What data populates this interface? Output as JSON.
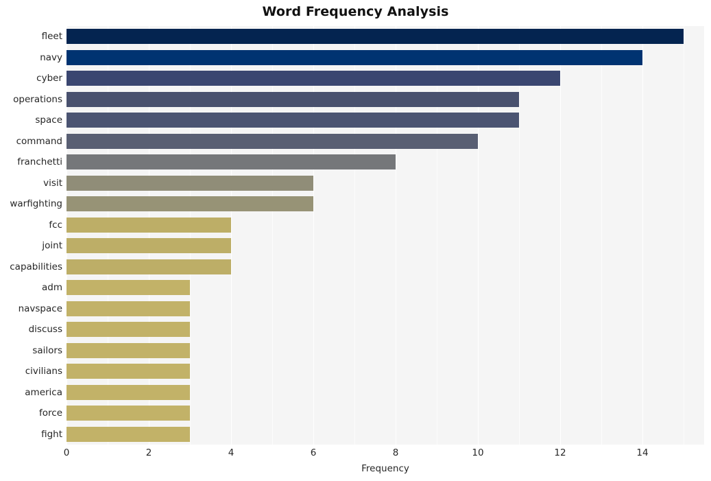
{
  "chart_data": {
    "type": "bar",
    "orientation": "horizontal",
    "title": "Word Frequency Analysis",
    "xlabel": "Frequency",
    "ylabel": "",
    "xlim": [
      0,
      15.5
    ],
    "xticks": [
      0,
      2,
      4,
      6,
      8,
      10,
      12,
      14
    ],
    "xtick_labels": [
      "0",
      "2",
      "4",
      "6",
      "8",
      "10",
      "12",
      "14"
    ],
    "grid": true,
    "grid_axis": "x",
    "legend": false,
    "legend_position": "none",
    "plot_background": "#f5f5f5",
    "figure_background": "#ffffff",
    "gridline_color": "#ffffff",
    "categories": [
      "fleet",
      "navy",
      "cyber",
      "operations",
      "space",
      "command",
      "franchetti",
      "visit",
      "warfighting",
      "fcc",
      "joint",
      "capabilities",
      "adm",
      "navspace",
      "discuss",
      "sailors",
      "civilians",
      "america",
      "force",
      "fight"
    ],
    "values": [
      15,
      14,
      12,
      11,
      11,
      10,
      8,
      6,
      6,
      4,
      4,
      4,
      3,
      3,
      3,
      3,
      3,
      3,
      3,
      3
    ],
    "bar_colors": [
      "#042450",
      "#003371",
      "#3a4670",
      "#49516e",
      "#4b5472",
      "#595f73",
      "#75777a",
      "#908d78",
      "#979376",
      "#bdae67",
      "#bdae67",
      "#bdae67",
      "#c2b268",
      "#c2b268",
      "#c2b268",
      "#c2b268",
      "#c2b268",
      "#c2b268",
      "#c2b268",
      "#c2b268"
    ]
  }
}
